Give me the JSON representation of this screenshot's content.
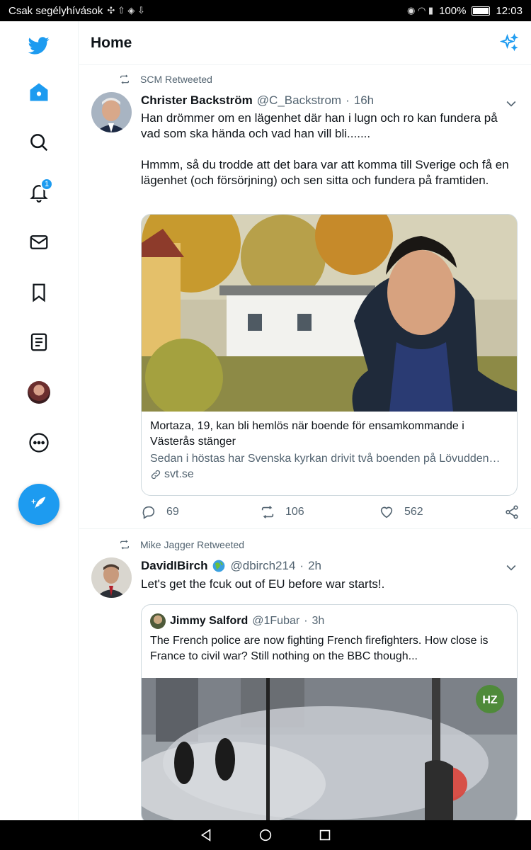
{
  "status_bar": {
    "carrier": "Csak segélyhívások",
    "battery": "100%",
    "time": "12:03"
  },
  "header": {
    "title": "Home"
  },
  "nav": {
    "notifications_badge": "1"
  },
  "tweets": [
    {
      "retweeted_by": "SCM Retweeted",
      "name": "Christer Backström",
      "handle": "@C_Backstrom",
      "dot": "·",
      "time": "16h",
      "text": "Han drömmer om en lägenhet där han i lugn och ro kan fundera på vad som ska hända och vad han vill bli.......\n\nHmmm, så du trodde att det bara var att komma till Sverige och få en lägenhet (och försörjning) och sen sitta och fundera på framtiden.",
      "card": {
        "title": "Mortaza, 19, kan bli hemlös när boende för ensamkommande i Västerås stänger",
        "description": "Sedan i höstas har Svenska kyrkan drivit två boenden på Lövudden…",
        "domain": "svt.se"
      },
      "replies": "69",
      "retweets": "106",
      "likes": "562"
    },
    {
      "retweeted_by": "Mike Jagger Retweeted",
      "name": "DavidIBirch",
      "handle": "@dbirch214",
      "dot": "·",
      "time": "2h",
      "text": "Let's get the fcuk out of EU before war starts!.",
      "quote": {
        "name": "Jimmy Salford",
        "handle": "@1Fubar",
        "dot": "·",
        "time": "3h",
        "text": "The French police are now fighting French firefighters. How close is France to civil war? Still nothing on the BBC though...",
        "watermark": "HZ"
      }
    }
  ],
  "colors": {
    "accent": "#1d9bf0",
    "text": "#0f1419",
    "muted": "#536471",
    "border": "#cfd9de"
  }
}
